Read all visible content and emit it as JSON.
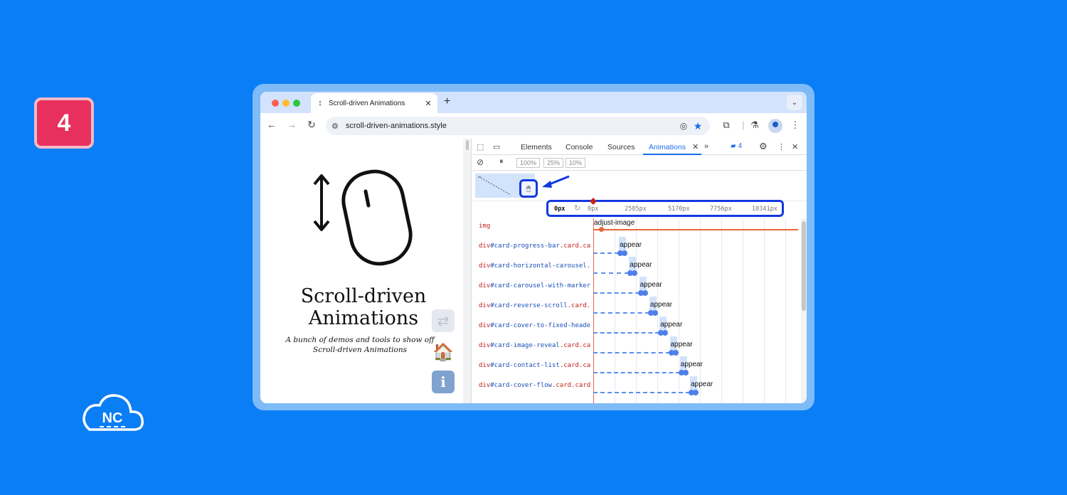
{
  "step_number": "4",
  "logo_text": "NC",
  "browser": {
    "tab_title": "Scroll-driven Animations",
    "url": "scroll-driven-animations.style"
  },
  "page": {
    "title_line1": "Scroll-driven",
    "title_line2": "Animations",
    "subtitle_line1": "A bunch of demos and tools to show off",
    "subtitle_line2": "Scroll-driven Animations"
  },
  "devtools": {
    "tabs": [
      "Elements",
      "Console",
      "Sources",
      "Animations"
    ],
    "active_tab": "Animations",
    "issues_count": "4",
    "speeds": [
      "100%",
      "25%",
      "10%"
    ],
    "ruler": {
      "current": "0px",
      "marks": [
        "0px",
        "2585px",
        "5170px",
        "7756px",
        "10341px"
      ]
    },
    "rows": [
      {
        "tag": "img",
        "id": "",
        "cls": "",
        "animation": "adjust-image"
      },
      {
        "tag": "div",
        "id": "#card-progress-bar",
        "cls": ".card.ca",
        "animation": "appear"
      },
      {
        "tag": "div",
        "id": "#card-horizontal-carousel",
        "cls": ".",
        "animation": "appear"
      },
      {
        "tag": "div",
        "id": "#card-carousel-with-marker",
        "cls": "",
        "animation": "appear"
      },
      {
        "tag": "div",
        "id": "#card-reverse-scroll",
        "cls": ".card.",
        "animation": "appear"
      },
      {
        "tag": "div",
        "id": "#card-cover-to-fixed-heade",
        "cls": "",
        "animation": "appear"
      },
      {
        "tag": "div",
        "id": "#card-image-reveal",
        "cls": ".card.ca",
        "animation": "appear"
      },
      {
        "tag": "div",
        "id": "#card-contact-list",
        "cls": ".card.ca",
        "animation": "appear"
      },
      {
        "tag": "div",
        "id": "#card-cover-flow",
        "cls": ".card.card",
        "animation": "appear"
      }
    ]
  },
  "colors": {
    "background": "#0a7ef5",
    "badge": "#e8305f",
    "highlight": "#1239e0",
    "accent": "#1a6ee8"
  }
}
